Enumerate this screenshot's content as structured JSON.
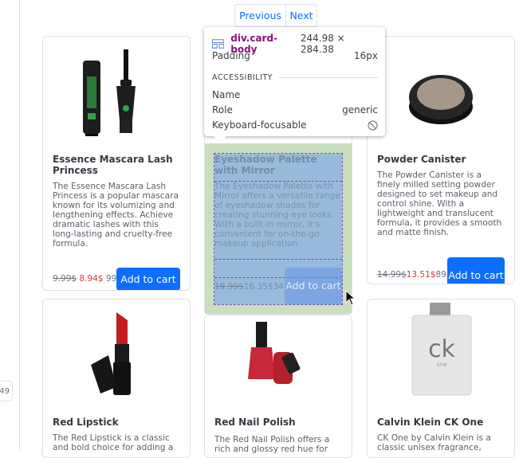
{
  "pagination": {
    "previous": "Previous",
    "next": "Next"
  },
  "side_chip": "49",
  "products": [
    {
      "title": "Essence Mascara Lash Princess",
      "description": "The Essence Mascara Lash Princess is a popular mascara known for its volumizing and lengthening effects. Achieve dramatic lashes with this long-lasting and cruelty-free formula.",
      "old_price": "9.99$",
      "new_price": "8.94$",
      "tail": "99",
      "button": "Add to cart"
    },
    {
      "title": "Eyeshadow Palette with Mirror",
      "description": "The Eyeshadow Palette with Mirror offers a versatile range of eyeshadow shades for creating stunning eye looks. With a built-in mirror, it's convenient for on-the-go makeup application.",
      "old_price": "19.99$",
      "new_price": "16.35$",
      "tail": "34",
      "button": "Add to cart"
    },
    {
      "title": "Powder Canister",
      "description": "The Powder Canister is a finely milled setting powder designed to set makeup and control shine. With a lightweight and translucent formula, it provides a smooth and matte finish.",
      "old_price": "14.99$",
      "new_price": "13.51$",
      "tail": "89",
      "button": "Add to cart"
    },
    {
      "title": "Red Lipstick",
      "description": "The Red Lipstick is a classic and bold choice for adding a"
    },
    {
      "title": "Red Nail Polish",
      "description": "The Red Nail Polish offers a rich and glossy red hue for"
    },
    {
      "title": "Calvin Klein CK One",
      "description": "CK One by Calvin Klein is a classic unisex fragrance,"
    }
  ],
  "inspector": {
    "element": "div.card-body",
    "dimensions": "244.98 × 284.38",
    "padding_label": "Padding",
    "padding_value": "16px",
    "section": "ACCESSIBILITY",
    "name_label": "Name",
    "name_value": "",
    "role_label": "Role",
    "role_value": "generic",
    "focus_label": "Keyboard-focusable"
  },
  "bottle_brand": "ck",
  "bottle_sub": "one",
  "colors": {
    "primary": "#0d6efd",
    "sale": "#dc3545",
    "highlight_padding": "#c9dfbd",
    "highlight_content": "#8fb4e1"
  }
}
